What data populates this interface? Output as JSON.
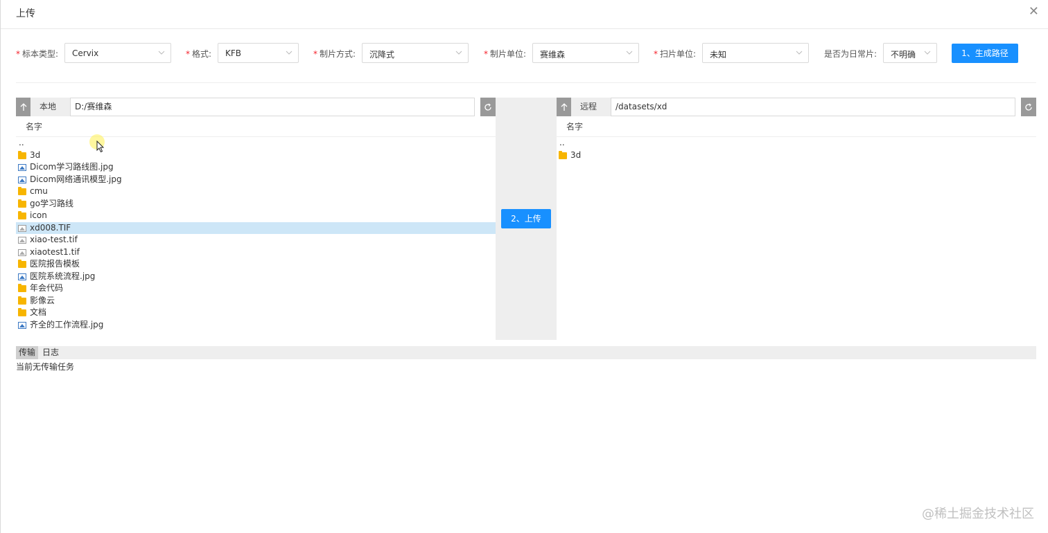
{
  "dialog": {
    "title": "上传",
    "close_glyph": "✕"
  },
  "form": {
    "fields": [
      {
        "label": "标本类型:",
        "required": true,
        "value": "Cervix"
      },
      {
        "label": "格式:",
        "required": true,
        "value": "KFB"
      },
      {
        "label": "制片方式:",
        "required": true,
        "value": "沉降式"
      },
      {
        "label": "制片单位:",
        "required": true,
        "value": "赛维森"
      },
      {
        "label": "扫片单位:",
        "required": true,
        "value": "未知"
      },
      {
        "label": "是否为日常片:",
        "required": false,
        "value": "不明确"
      }
    ],
    "required_mark": "*",
    "generate_button": "1、生成路径"
  },
  "local": {
    "label": "本地",
    "path": "D:/赛维森",
    "column_header": "名字",
    "files": [
      {
        "name": "..",
        "type": "parent"
      },
      {
        "name": "3d",
        "type": "folder"
      },
      {
        "name": "Dicom学习路线图.jpg",
        "type": "image"
      },
      {
        "name": "Dicom网络通讯模型.jpg",
        "type": "image"
      },
      {
        "name": "cmu",
        "type": "folder"
      },
      {
        "name": "go学习路线",
        "type": "folder"
      },
      {
        "name": "icon",
        "type": "folder"
      },
      {
        "name": "xd008.TIF",
        "type": "tif",
        "selected": true
      },
      {
        "name": "xiao-test.tif",
        "type": "tif"
      },
      {
        "name": "xiaotest1.tif",
        "type": "tif"
      },
      {
        "name": "医院报告模板",
        "type": "folder"
      },
      {
        "name": "医院系统流程.jpg",
        "type": "image"
      },
      {
        "name": "年会代码",
        "type": "folder"
      },
      {
        "name": "影像云",
        "type": "folder"
      },
      {
        "name": "文档",
        "type": "folder"
      },
      {
        "name": "齐全的工作流程.jpg",
        "type": "image"
      }
    ]
  },
  "remote": {
    "label": "远程",
    "path": "/datasets/xd",
    "column_header": "名字",
    "files": [
      {
        "name": "..",
        "type": "parent"
      },
      {
        "name": "3d",
        "type": "folder"
      }
    ]
  },
  "upload_button": "2、上传",
  "bottom": {
    "tabs": [
      "传输",
      "日志"
    ],
    "active_tab": "传输",
    "status": "当前无传输任务"
  },
  "watermark": "@稀土掘金技术社区",
  "colors": {
    "primary": "#1890ff",
    "required": "#f5222d",
    "selected_row": "#cde6f7",
    "folder": "#f7b500"
  },
  "icons": [
    "up-arrow-icon",
    "refresh-icon",
    "folder-icon",
    "image-file-icon",
    "tif-file-icon",
    "chevron-down-icon",
    "close-icon"
  ]
}
